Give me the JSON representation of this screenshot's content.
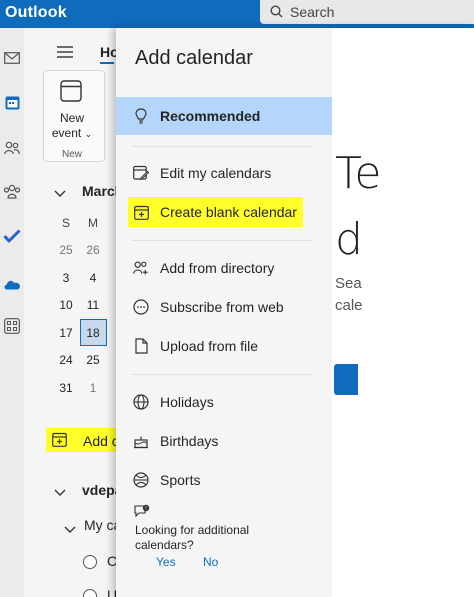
{
  "app": {
    "name": "Outlook"
  },
  "search": {
    "label": "Search"
  },
  "ribbon": {
    "tab_home": "Ho",
    "new_event": "New event",
    "group_label": "New"
  },
  "mini_calendar": {
    "month": "March",
    "weekday_headers": [
      "S",
      "M"
    ],
    "weeks": [
      [
        "25",
        "26"
      ],
      [
        "3",
        "4"
      ],
      [
        "10",
        "11"
      ],
      [
        "17",
        "18"
      ],
      [
        "24",
        "25"
      ],
      [
        "31",
        "1"
      ]
    ],
    "today": "18"
  },
  "left_nav": {
    "add_calendar": "Add c",
    "account": "vdepa",
    "my_calendars": "My ca",
    "calendar_items": [
      "C",
      "U"
    ]
  },
  "panel": {
    "title": "Add calendar",
    "items": {
      "recommended": "Recommended",
      "edit": "Edit my calendars",
      "create_blank": "Create blank calendar",
      "directory": "Add from directory",
      "subscribe": "Subscribe from web",
      "upload": "Upload from file",
      "holidays": "Holidays",
      "birthdays": "Birthdays",
      "sports": "Sports"
    },
    "feedback": {
      "question": "Looking for additional calendars?",
      "yes": "Yes",
      "no": "No"
    }
  },
  "right_pane": {
    "line1": "Te",
    "line2": "d",
    "text1": "Sea",
    "text2": "cale"
  },
  "colors": {
    "brand": "#0f6cbd",
    "selected": "#b4d6fa",
    "highlight": "#ffff29"
  }
}
